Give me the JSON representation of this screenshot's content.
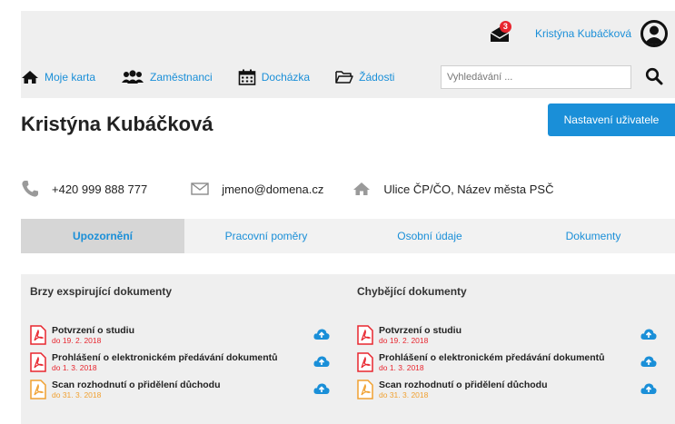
{
  "header": {
    "notification_count": "3",
    "user_name": "Kristýna Kubáčková"
  },
  "nav": {
    "items": [
      {
        "label": "Moje karta",
        "icon": "home-icon"
      },
      {
        "label": "Zaměstnanci",
        "icon": "users-icon"
      },
      {
        "label": "Docházka",
        "icon": "calendar-icon"
      },
      {
        "label": "Žádosti",
        "icon": "folder-icon"
      }
    ],
    "search_placeholder": "Vyhledávání ..."
  },
  "page": {
    "title": "Kristýna Kubáčková",
    "settings_button": "Nastavení uživatele"
  },
  "contacts": {
    "phone": "+420 999 888 777",
    "email": "jmeno@domena.cz",
    "address": "Ulice ČP/ČO, Název města PSČ"
  },
  "tabs": [
    {
      "label": "Upozornění",
      "active": true
    },
    {
      "label": "Pracovní poměry",
      "active": false
    },
    {
      "label": "Osobní údaje",
      "active": false
    },
    {
      "label": "Dokumenty",
      "active": false
    }
  ],
  "panels": {
    "expiring": {
      "title": "Brzy exspirující dokumenty",
      "docs": [
        {
          "name": "Potvrzení o studiu",
          "date": "do 19. 2. 2018",
          "color": "#e8262f"
        },
        {
          "name": "Prohlášení o elektronickém předávání dokumentů",
          "date": "do 1. 3. 2018",
          "color": "#e8262f"
        },
        {
          "name": "Scan rozhodnutí o přidělení důchodu",
          "date": "do 31. 3. 2018",
          "color": "#f0a030"
        }
      ]
    },
    "missing": {
      "title": "Chybějící dokumenty",
      "docs": [
        {
          "name": "Potvrzení o studiu",
          "date": "do 19. 2. 2018",
          "color": "#e8262f"
        },
        {
          "name": "Prohlášení o elektronickém předávání dokumentů",
          "date": "do 1. 3. 2018",
          "color": "#e8262f"
        },
        {
          "name": "Scan rozhodnutí o přidělení důchodu",
          "date": "do 31. 3. 2018",
          "color": "#f0a030"
        }
      ]
    }
  },
  "colors": {
    "accent": "#1a8fd8",
    "danger": "#e8262f",
    "warning": "#f0a030"
  }
}
